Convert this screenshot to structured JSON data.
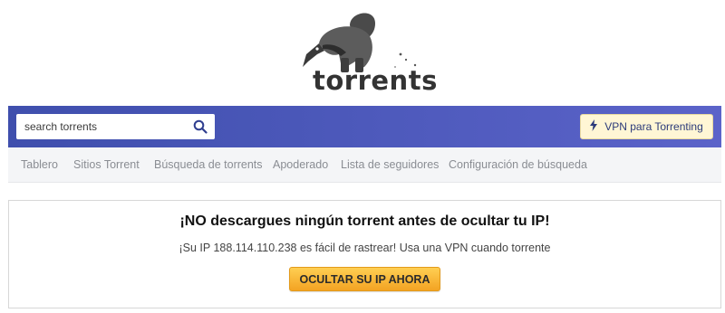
{
  "logo": {
    "text": "torrents"
  },
  "search": {
    "placeholder": "search torrents",
    "icon": "search-icon"
  },
  "vpn_button": {
    "label": "VPN para Torrenting",
    "icon": "lightning-bolt-icon"
  },
  "nav": {
    "items": [
      {
        "label": "Tablero"
      },
      {
        "label": "Sitios Torrent"
      },
      {
        "label": "Búsqueda de torrents"
      },
      {
        "label": "Apoderado"
      },
      {
        "label": "Lista de seguidores"
      },
      {
        "label": "Configuración de búsqueda"
      }
    ]
  },
  "warning": {
    "title": "¡NO descargues ningún torrent antes de ocultar tu IP!",
    "subtitle": "¡Su IP 188.114.110.238 es fácil de rastrear! Usa una VPN cuando torrente",
    "button_label": "OCULTAR SU IP AHORA"
  },
  "colors": {
    "bar_start": "#3f4fad",
    "bar_end": "#5b63c9",
    "vpn_button_bg": "#fff6d5",
    "cta_orange": "#f3a323"
  }
}
